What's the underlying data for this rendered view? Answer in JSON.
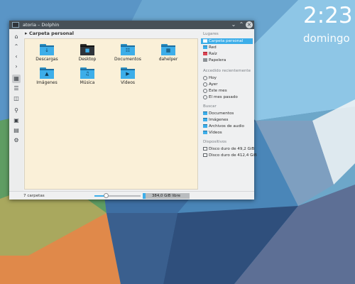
{
  "clock": {
    "time": "2:23",
    "date": "domingo"
  },
  "window": {
    "title": "atoria – Dolphin",
    "icons": [
      "dolphin-app-icon",
      "chevron-down-icon",
      "chevron-up-icon",
      "close-icon"
    ]
  },
  "toolbar": {
    "icons": [
      "home-icon",
      "up-icon",
      "back-icon",
      "forward-icon",
      "icons-view-icon",
      "details-view-icon",
      "split-view-icon",
      "search-icon",
      "preview-icon",
      "info-panel-icon",
      "settings-icon"
    ]
  },
  "breadcrumb": {
    "current": "Carpeta personal"
  },
  "folders": [
    {
      "label": "Descargas",
      "icon": "download-icon"
    },
    {
      "label": "Desktop",
      "icon": "desktop-icon"
    },
    {
      "label": "Documentos",
      "icon": "document-icon"
    },
    {
      "label": "dahelper",
      "icon": "apps-grid-icon"
    },
    {
      "label": "Imágenes",
      "icon": "image-icon"
    },
    {
      "label": "Música",
      "icon": "music-icon"
    },
    {
      "label": "Vídeos",
      "icon": "video-icon"
    }
  ],
  "places": {
    "lugares_title": "Lugares",
    "lugares": [
      {
        "label": "Carpeta personal",
        "selected": true
      },
      {
        "label": "Red",
        "selected": false
      },
      {
        "label": "Raíz",
        "selected": false
      },
      {
        "label": "Papelera",
        "selected": false
      }
    ],
    "recent_title": "Accedido recientemente",
    "recent": [
      "Hoy",
      "Ayer",
      "Este mes",
      "El mes pasado"
    ],
    "search_title": "Buscar",
    "search": [
      "Documentos",
      "Imágenes",
      "Archivos de audio",
      "Vídeos"
    ],
    "devices_title": "Dispositivos",
    "devices": [
      "Disco duro de 49,2 GiB",
      "Disco duro de 412,4 GiB"
    ]
  },
  "status": {
    "count": "7 carpetas",
    "zoom_level": 0.25,
    "free_space": "384,0 GiB libre",
    "disk_used_fraction": 0.06
  },
  "colors": {
    "accent": "#3daee9",
    "titlebar": "#475057",
    "view_bg": "#faf0d8"
  }
}
